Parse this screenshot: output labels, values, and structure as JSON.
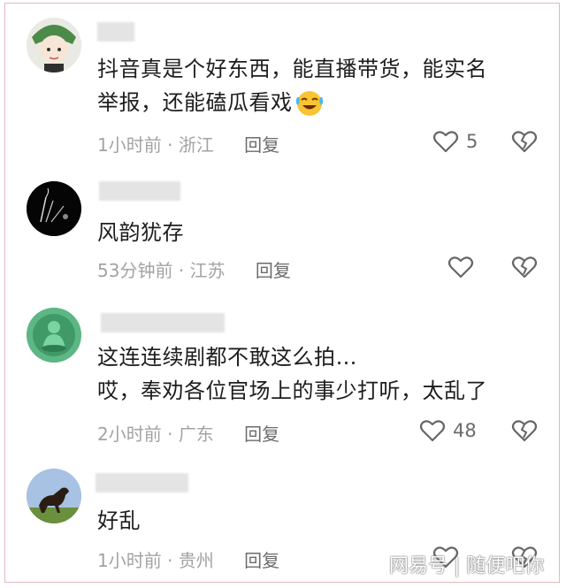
{
  "comments": [
    {
      "text_lines": [
        "抖音真是个好东西，能直播带货，能实名",
        "举报，还能磕瓜看戏"
      ],
      "emoji": "laughing-crying-emoji",
      "time": "1小时前",
      "location": "浙江",
      "reply_label": "回复",
      "like_count": "5",
      "avatar": "cartoon-avatar"
    },
    {
      "text_lines": [
        "风韵犹存"
      ],
      "time": "53分钟前",
      "location": "江苏",
      "reply_label": "回复",
      "like_count": "",
      "avatar": "dark-feather-avatar"
    },
    {
      "text_lines": [
        "这连连续剧都不敢这么拍…",
        "哎，奉劝各位官场上的事少打听，太乱了"
      ],
      "time": "2小时前",
      "location": "广东",
      "reply_label": "回复",
      "like_count": "48",
      "avatar": "jade-buddha-avatar"
    },
    {
      "text_lines": [
        "好乱"
      ],
      "time": "1小时前",
      "location": "贵州",
      "reply_label": "回复",
      "like_count": "",
      "avatar": "horse-avatar"
    }
  ],
  "separator": "·",
  "watermark": "网易号 | 随便吧你",
  "colors": {
    "meta": "#a3a3a3",
    "reply": "#6b6b6b",
    "frame": "#e2b8bd"
  }
}
